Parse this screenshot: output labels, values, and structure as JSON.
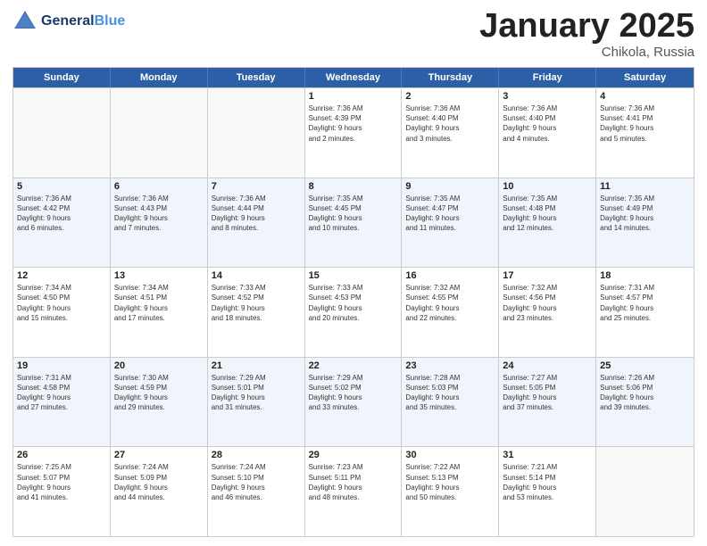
{
  "logo": {
    "line1": "General",
    "line2": "Blue"
  },
  "title": {
    "month": "January 2025",
    "location": "Chikola, Russia"
  },
  "header_days": [
    "Sunday",
    "Monday",
    "Tuesday",
    "Wednesday",
    "Thursday",
    "Friday",
    "Saturday"
  ],
  "weeks": [
    [
      {
        "day": "",
        "info": ""
      },
      {
        "day": "",
        "info": ""
      },
      {
        "day": "",
        "info": ""
      },
      {
        "day": "1",
        "info": "Sunrise: 7:36 AM\nSunset: 4:39 PM\nDaylight: 9 hours\nand 2 minutes."
      },
      {
        "day": "2",
        "info": "Sunrise: 7:36 AM\nSunset: 4:40 PM\nDaylight: 9 hours\nand 3 minutes."
      },
      {
        "day": "3",
        "info": "Sunrise: 7:36 AM\nSunset: 4:40 PM\nDaylight: 9 hours\nand 4 minutes."
      },
      {
        "day": "4",
        "info": "Sunrise: 7:36 AM\nSunset: 4:41 PM\nDaylight: 9 hours\nand 5 minutes."
      }
    ],
    [
      {
        "day": "5",
        "info": "Sunrise: 7:36 AM\nSunset: 4:42 PM\nDaylight: 9 hours\nand 6 minutes."
      },
      {
        "day": "6",
        "info": "Sunrise: 7:36 AM\nSunset: 4:43 PM\nDaylight: 9 hours\nand 7 minutes."
      },
      {
        "day": "7",
        "info": "Sunrise: 7:36 AM\nSunset: 4:44 PM\nDaylight: 9 hours\nand 8 minutes."
      },
      {
        "day": "8",
        "info": "Sunrise: 7:35 AM\nSunset: 4:45 PM\nDaylight: 9 hours\nand 10 minutes."
      },
      {
        "day": "9",
        "info": "Sunrise: 7:35 AM\nSunset: 4:47 PM\nDaylight: 9 hours\nand 11 minutes."
      },
      {
        "day": "10",
        "info": "Sunrise: 7:35 AM\nSunset: 4:48 PM\nDaylight: 9 hours\nand 12 minutes."
      },
      {
        "day": "11",
        "info": "Sunrise: 7:35 AM\nSunset: 4:49 PM\nDaylight: 9 hours\nand 14 minutes."
      }
    ],
    [
      {
        "day": "12",
        "info": "Sunrise: 7:34 AM\nSunset: 4:50 PM\nDaylight: 9 hours\nand 15 minutes."
      },
      {
        "day": "13",
        "info": "Sunrise: 7:34 AM\nSunset: 4:51 PM\nDaylight: 9 hours\nand 17 minutes."
      },
      {
        "day": "14",
        "info": "Sunrise: 7:33 AM\nSunset: 4:52 PM\nDaylight: 9 hours\nand 18 minutes."
      },
      {
        "day": "15",
        "info": "Sunrise: 7:33 AM\nSunset: 4:53 PM\nDaylight: 9 hours\nand 20 minutes."
      },
      {
        "day": "16",
        "info": "Sunrise: 7:32 AM\nSunset: 4:55 PM\nDaylight: 9 hours\nand 22 minutes."
      },
      {
        "day": "17",
        "info": "Sunrise: 7:32 AM\nSunset: 4:56 PM\nDaylight: 9 hours\nand 23 minutes."
      },
      {
        "day": "18",
        "info": "Sunrise: 7:31 AM\nSunset: 4:57 PM\nDaylight: 9 hours\nand 25 minutes."
      }
    ],
    [
      {
        "day": "19",
        "info": "Sunrise: 7:31 AM\nSunset: 4:58 PM\nDaylight: 9 hours\nand 27 minutes."
      },
      {
        "day": "20",
        "info": "Sunrise: 7:30 AM\nSunset: 4:59 PM\nDaylight: 9 hours\nand 29 minutes."
      },
      {
        "day": "21",
        "info": "Sunrise: 7:29 AM\nSunset: 5:01 PM\nDaylight: 9 hours\nand 31 minutes."
      },
      {
        "day": "22",
        "info": "Sunrise: 7:29 AM\nSunset: 5:02 PM\nDaylight: 9 hours\nand 33 minutes."
      },
      {
        "day": "23",
        "info": "Sunrise: 7:28 AM\nSunset: 5:03 PM\nDaylight: 9 hours\nand 35 minutes."
      },
      {
        "day": "24",
        "info": "Sunrise: 7:27 AM\nSunset: 5:05 PM\nDaylight: 9 hours\nand 37 minutes."
      },
      {
        "day": "25",
        "info": "Sunrise: 7:26 AM\nSunset: 5:06 PM\nDaylight: 9 hours\nand 39 minutes."
      }
    ],
    [
      {
        "day": "26",
        "info": "Sunrise: 7:25 AM\nSunset: 5:07 PM\nDaylight: 9 hours\nand 41 minutes."
      },
      {
        "day": "27",
        "info": "Sunrise: 7:24 AM\nSunset: 5:09 PM\nDaylight: 9 hours\nand 44 minutes."
      },
      {
        "day": "28",
        "info": "Sunrise: 7:24 AM\nSunset: 5:10 PM\nDaylight: 9 hours\nand 46 minutes."
      },
      {
        "day": "29",
        "info": "Sunrise: 7:23 AM\nSunset: 5:11 PM\nDaylight: 9 hours\nand 48 minutes."
      },
      {
        "day": "30",
        "info": "Sunrise: 7:22 AM\nSunset: 5:13 PM\nDaylight: 9 hours\nand 50 minutes."
      },
      {
        "day": "31",
        "info": "Sunrise: 7:21 AM\nSunset: 5:14 PM\nDaylight: 9 hours\nand 53 minutes."
      },
      {
        "day": "",
        "info": ""
      }
    ]
  ],
  "alt_rows": [
    1,
    3
  ]
}
